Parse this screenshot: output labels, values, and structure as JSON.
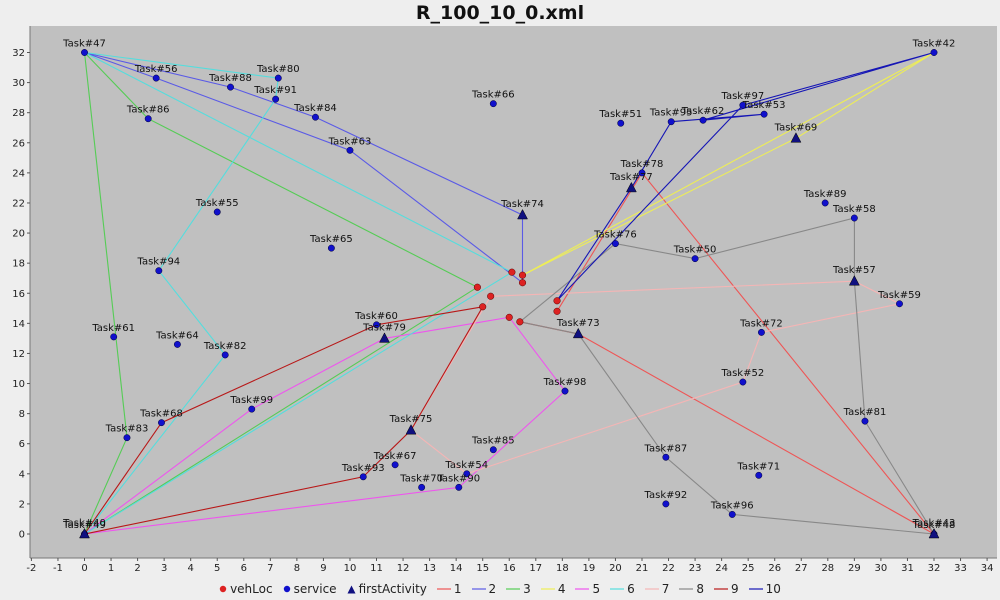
{
  "chart_data": {
    "type": "scatter",
    "title": "R_100_10_0.xml",
    "xlim": [
      -2,
      34
    ],
    "ylim": [
      -2,
      33
    ],
    "xticks": [
      -2,
      -1,
      0,
      1,
      2,
      3,
      4,
      5,
      6,
      7,
      8,
      9,
      10,
      11,
      12,
      13,
      14,
      15,
      16,
      17,
      18,
      19,
      20,
      21,
      22,
      23,
      24,
      25,
      26,
      27,
      28,
      29,
      30,
      31,
      32,
      33,
      34
    ],
    "yticks": [
      0,
      2,
      4,
      6,
      8,
      10,
      12,
      14,
      16,
      18,
      20,
      22,
      24,
      26,
      28,
      30,
      32
    ],
    "grid": false,
    "legend_position": "bottom",
    "vehLoc": [
      [
        15.0,
        15.1
      ],
      [
        15.3,
        15.8
      ],
      [
        14.8,
        16.4
      ],
      [
        16.5,
        16.7
      ],
      [
        16.5,
        17.2
      ],
      [
        16.1,
        17.4
      ],
      [
        17.8,
        15.5
      ],
      [
        17.8,
        14.8
      ],
      [
        16.0,
        14.4
      ],
      [
        16.4,
        14.1
      ]
    ],
    "service": [
      {
        "name": "Task#47",
        "x": 0,
        "y": 32
      },
      {
        "name": "Task#56",
        "x": 2.7,
        "y": 30.3
      },
      {
        "name": "Task#88",
        "x": 5.5,
        "y": 29.7
      },
      {
        "name": "Task#80",
        "x": 7.3,
        "y": 30.3
      },
      {
        "name": "Task#91",
        "x": 7.2,
        "y": 28.9
      },
      {
        "name": "Task#84",
        "x": 8.7,
        "y": 27.7
      },
      {
        "name": "Task#86",
        "x": 2.4,
        "y": 27.6
      },
      {
        "name": "Task#63",
        "x": 10.0,
        "y": 25.5
      },
      {
        "name": "Task#66",
        "x": 15.4,
        "y": 28.6
      },
      {
        "name": "Task#51",
        "x": 20.2,
        "y": 27.3
      },
      {
        "name": "Task#95",
        "x": 22.1,
        "y": 27.4
      },
      {
        "name": "Task#62",
        "x": 23.3,
        "y": 27.5
      },
      {
        "name": "Task#97",
        "x": 24.8,
        "y": 28.5
      },
      {
        "name": "Task#53",
        "x": 25.6,
        "y": 27.9
      },
      {
        "name": "Task#42",
        "x": 32,
        "y": 32
      },
      {
        "name": "Task#78",
        "x": 21.0,
        "y": 24.0
      },
      {
        "name": "Task#89",
        "x": 27.9,
        "y": 22.0
      },
      {
        "name": "Task#58",
        "x": 29.0,
        "y": 21.0
      },
      {
        "name": "Task#55",
        "x": 5.0,
        "y": 21.4
      },
      {
        "name": "Task#65",
        "x": 9.3,
        "y": 19.0
      },
      {
        "name": "Task#76",
        "x": 20.0,
        "y": 19.3
      },
      {
        "name": "Task#50",
        "x": 23.0,
        "y": 18.3
      },
      {
        "name": "Task#94",
        "x": 2.8,
        "y": 17.5
      },
      {
        "name": "Task#59",
        "x": 30.7,
        "y": 15.3
      },
      {
        "name": "Task#60",
        "x": 11.0,
        "y": 13.9
      },
      {
        "name": "Task#61",
        "x": 1.1,
        "y": 13.1
      },
      {
        "name": "Task#64",
        "x": 3.5,
        "y": 12.6
      },
      {
        "name": "Task#82",
        "x": 5.3,
        "y": 11.9
      },
      {
        "name": "Task#72",
        "x": 25.5,
        "y": 13.4
      },
      {
        "name": "Task#52",
        "x": 24.8,
        "y": 10.1
      },
      {
        "name": "Task#98",
        "x": 18.1,
        "y": 9.5
      },
      {
        "name": "Task#99",
        "x": 6.3,
        "y": 8.3
      },
      {
        "name": "Task#68",
        "x": 2.9,
        "y": 7.4
      },
      {
        "name": "Task#81",
        "x": 29.4,
        "y": 7.5
      },
      {
        "name": "Task#83",
        "x": 1.6,
        "y": 6.4
      },
      {
        "name": "Task#85",
        "x": 15.4,
        "y": 5.6
      },
      {
        "name": "Task#87",
        "x": 21.9,
        "y": 5.1
      },
      {
        "name": "Task#67",
        "x": 11.7,
        "y": 4.6
      },
      {
        "name": "Task#71",
        "x": 25.4,
        "y": 3.9
      },
      {
        "name": "Task#93",
        "x": 10.5,
        "y": 3.8
      },
      {
        "name": "Task#54",
        "x": 14.4,
        "y": 4.0
      },
      {
        "name": "Task#70",
        "x": 12.7,
        "y": 3.1
      },
      {
        "name": "Task#90",
        "x": 14.1,
        "y": 3.1
      },
      {
        "name": "Task#92",
        "x": 21.9,
        "y": 2.0
      },
      {
        "name": "Task#96",
        "x": 24.4,
        "y": 1.3
      },
      {
        "name": "Task#49",
        "x": 0,
        "y": 0
      },
      {
        "name": "Task#48",
        "x": 32,
        "y": 0
      }
    ],
    "firstActivity": [
      {
        "name": "Task#74",
        "x": 16.5,
        "y": 21.2
      },
      {
        "name": "Task#77",
        "x": 20.6,
        "y": 23.0
      },
      {
        "name": "Task#69",
        "x": 26.8,
        "y": 26.3
      },
      {
        "name": "Task#57",
        "x": 29.0,
        "y": 16.8
      },
      {
        "name": "Task#79",
        "x": 11.3,
        "y": 13.0
      },
      {
        "name": "Task#73",
        "x": 18.6,
        "y": 13.3
      },
      {
        "name": "Task#75",
        "x": 12.3,
        "y": 6.9
      },
      {
        "name": "Task#40",
        "x": 0,
        "y": 0
      },
      {
        "name": "Task#43",
        "x": 32,
        "y": 0
      }
    ],
    "routes": [
      {
        "name": "1",
        "color": "#ee5555",
        "points": [
          [
            17.8,
            14.8
          ],
          [
            21.0,
            24.0
          ],
          [
            32,
            0
          ],
          [
            18.6,
            13.3
          ],
          [
            16.4,
            14.1
          ]
        ]
      },
      {
        "name": "2",
        "color": "#5a5ae6",
        "points": [
          [
            16.5,
            16.7
          ],
          [
            16.5,
            21.2
          ],
          [
            8.7,
            27.7
          ],
          [
            5.5,
            29.7
          ],
          [
            0,
            32
          ],
          [
            2.7,
            30.3
          ],
          [
            10.0,
            25.5
          ],
          [
            16.5,
            16.7
          ]
        ]
      },
      {
        "name": "3",
        "color": "#55cc55",
        "points": [
          [
            14.8,
            16.4
          ],
          [
            2.4,
            27.6
          ],
          [
            0,
            32
          ],
          [
            1.6,
            6.4
          ],
          [
            0,
            0
          ],
          [
            14.8,
            16.4
          ]
        ]
      },
      {
        "name": "4",
        "color": "#eeee55",
        "points": [
          [
            16.5,
            17.2
          ],
          [
            26.8,
            26.3
          ],
          [
            32,
            32
          ],
          [
            16.5,
            17.2
          ]
        ]
      },
      {
        "name": "5",
        "color": "#ee55ee",
        "points": [
          [
            16.0,
            14.4
          ],
          [
            18.1,
            9.5
          ],
          [
            14.1,
            3.1
          ],
          [
            0,
            0
          ],
          [
            6.3,
            8.3
          ],
          [
            11.3,
            13.0
          ],
          [
            16.0,
            14.4
          ]
        ]
      },
      {
        "name": "6",
        "color": "#55dddd",
        "points": [
          [
            16.1,
            17.4
          ],
          [
            0,
            32
          ],
          [
            7.3,
            30.3
          ],
          [
            7.2,
            28.9
          ],
          [
            2.8,
            17.5
          ],
          [
            5.3,
            11.9
          ],
          [
            0,
            0
          ],
          [
            16.1,
            17.4
          ]
        ]
      },
      {
        "name": "7",
        "color": "#f5b5b5",
        "points": [
          [
            15.3,
            15.8
          ],
          [
            29.0,
            16.8
          ],
          [
            30.7,
            15.3
          ],
          [
            25.5,
            13.4
          ],
          [
            24.8,
            10.1
          ],
          [
            14.4,
            4.0
          ],
          [
            12.3,
            6.9
          ],
          [
            15.3,
            15.8
          ]
        ]
      },
      {
        "name": "8",
        "color": "#888888",
        "points": [
          [
            16.4,
            14.1
          ],
          [
            20.0,
            19.3
          ],
          [
            23.0,
            18.3
          ],
          [
            29.0,
            21.0
          ],
          [
            29.0,
            16.8
          ],
          [
            29.4,
            7.5
          ],
          [
            32,
            0
          ],
          [
            24.4,
            1.3
          ],
          [
            21.9,
            5.1
          ],
          [
            18.6,
            13.3
          ],
          [
            16.4,
            14.1
          ]
        ]
      },
      {
        "name": "9",
        "color": "#b81818",
        "points": [
          [
            15.0,
            15.1
          ],
          [
            11.0,
            13.9
          ],
          [
            2.9,
            7.4
          ],
          [
            0,
            0
          ],
          [
            10.5,
            3.8
          ],
          [
            12.3,
            6.9
          ],
          [
            15.0,
            15.1
          ]
        ]
      },
      {
        "name": "10",
        "color": "#1515b5",
        "points": [
          [
            17.8,
            15.5
          ],
          [
            20.6,
            23.0
          ],
          [
            22.1,
            27.4
          ],
          [
            25.6,
            27.9
          ],
          [
            23.3,
            27.5
          ],
          [
            32,
            32
          ],
          [
            24.8,
            28.5
          ],
          [
            17.8,
            15.5
          ]
        ]
      }
    ]
  },
  "legend": {
    "vehLoc": "vehLoc",
    "service": "service",
    "firstActivity": "firstActivity",
    "r1": "1",
    "r2": "2",
    "r3": "3",
    "r4": "4",
    "r5": "5",
    "r6": "6",
    "r7": "7",
    "r8": "8",
    "r9": "9",
    "r10": "10"
  },
  "colors": {
    "plot_bg": "#c0c0c0",
    "vehLoc": "#dd2222",
    "service": "#1010cc",
    "firstActivity": "#101080"
  }
}
